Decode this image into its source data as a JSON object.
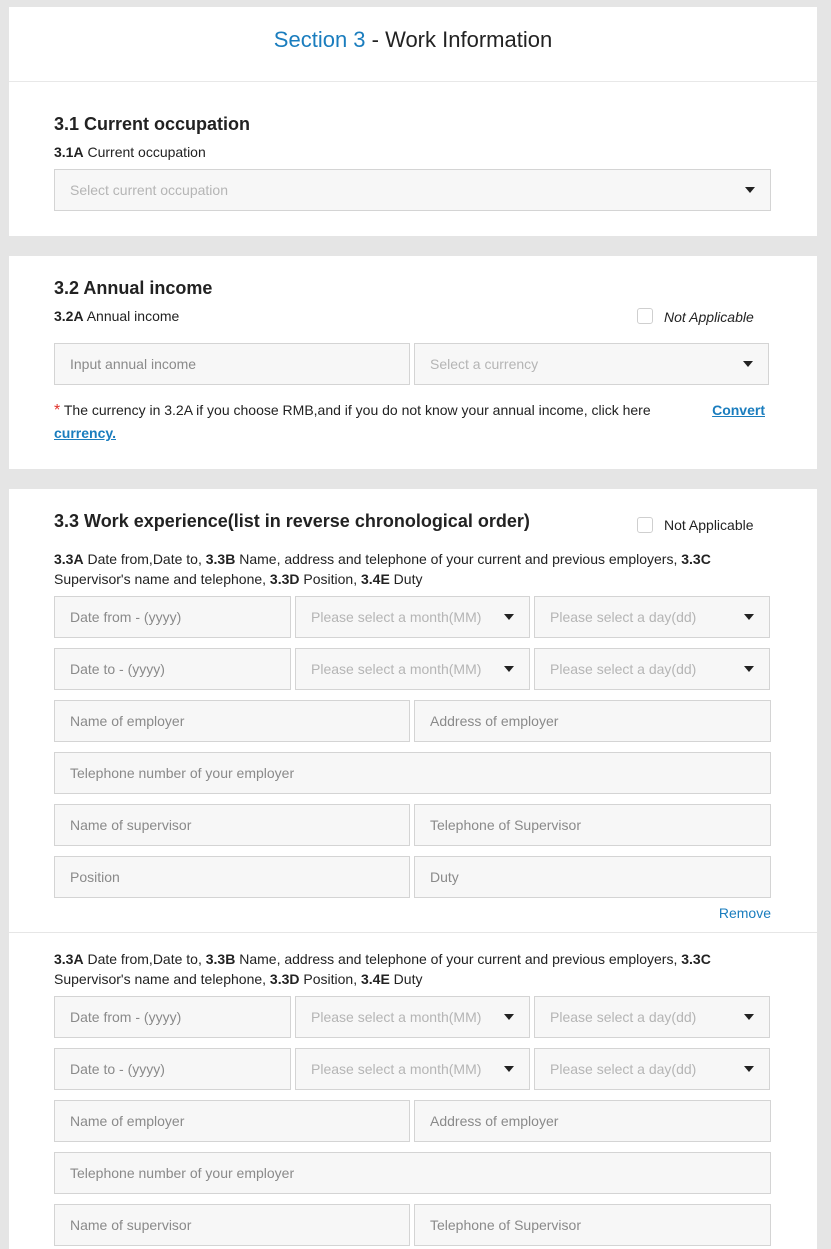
{
  "header": {
    "section_num": "Section 3",
    "section_rest": " - Work Information"
  },
  "s31": {
    "title": "3.1 Current occupation",
    "sub_code": "3.1A",
    "sub_label": " Current occupation",
    "occupation_placeholder": "Select current occupation"
  },
  "s32": {
    "title": "3.2 Annual income",
    "sub_code": "3.2A",
    "sub_label": " Annual income",
    "not_applicable": "Not Applicable",
    "income_placeholder": "Input annual income",
    "currency_placeholder": "Select a currency",
    "note_star": "*",
    "note_text": " The currency in 3.2A if you choose RMB,and if you do not know your annual income, click here ",
    "convert_link_1": "Convert",
    "convert_link_2": "currency."
  },
  "s33": {
    "title": "3.3 Work experience(list in reverse chronological order)",
    "not_applicable": "Not Applicable",
    "desc": {
      "c1": "3.3A",
      "t1": " Date from,Date to, ",
      "c2": "3.3B",
      "t2": " Name, address and telephone of your current and previous employers, ",
      "c3": "3.3C",
      "t3": "Supervisor's name and telephone, ",
      "c4": "3.3D",
      "t4": " Position, ",
      "c5": "3.4E",
      "t5": " Duty"
    },
    "fields": {
      "date_from": "Date from - (yyyy)",
      "date_to": "Date to - (yyyy)",
      "month": "Please select a month(MM)",
      "day": "Please select a day(dd)",
      "employer_name": "Name of employer",
      "employer_address": "Address of employer",
      "employer_phone": "Telephone number of your employer",
      "supervisor_name": "Name of supervisor",
      "supervisor_phone": "Telephone of Supervisor",
      "position": "Position",
      "duty": "Duty"
    },
    "remove_label": "Remove"
  }
}
